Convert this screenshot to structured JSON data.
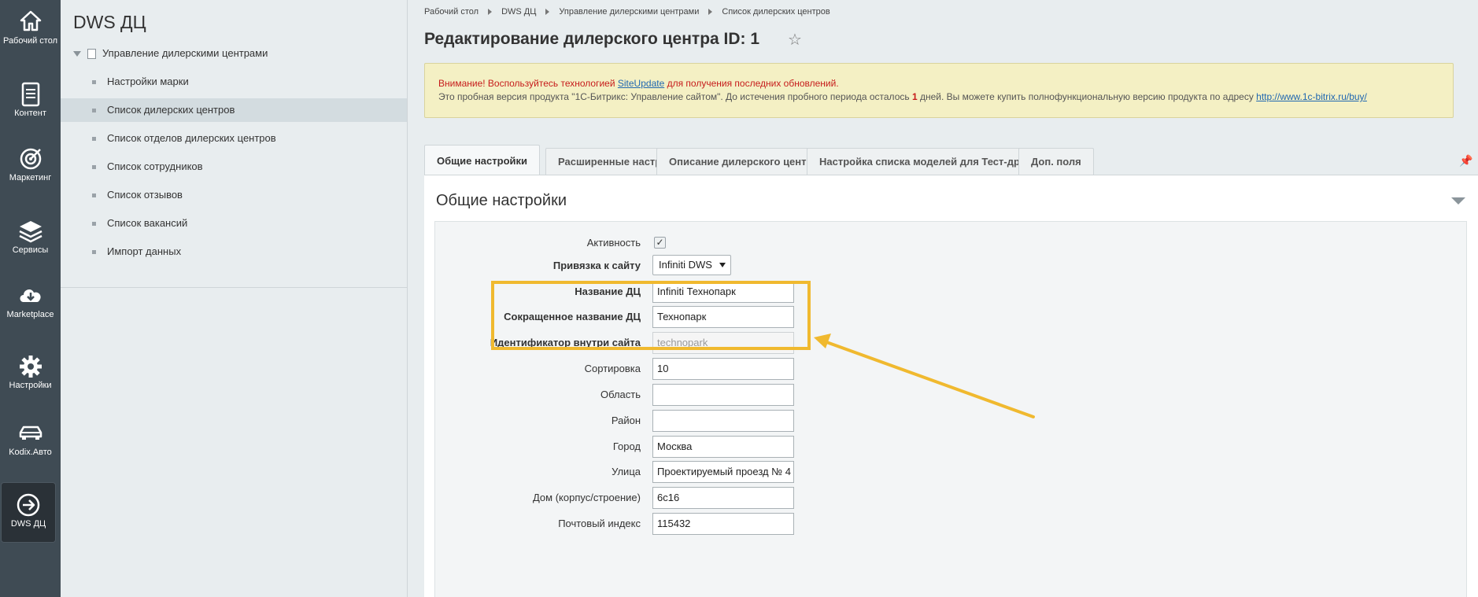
{
  "iconbar": {
    "items": [
      {
        "label": "Рабочий стол",
        "icon": "home-icon"
      },
      {
        "label": "Контент",
        "icon": "document-icon"
      },
      {
        "label": "Маркетинг",
        "icon": "target-icon"
      },
      {
        "label": "Сервисы",
        "icon": "layers-icon"
      },
      {
        "label": "Marketplace",
        "icon": "cloud-download-icon"
      },
      {
        "label": "Настройки",
        "icon": "gear-icon"
      },
      {
        "label": "Kodix.Авто",
        "icon": "car-icon"
      },
      {
        "label": "DWS ДЦ",
        "icon": "arrow-circle-icon"
      }
    ]
  },
  "menu": {
    "title": "DWS ДЦ",
    "root": "Управление дилерскими центрами",
    "items": [
      {
        "label": "Настройки марки"
      },
      {
        "label": "Список дилерских центров"
      },
      {
        "label": "Список отделов дилерских центров"
      },
      {
        "label": "Список сотрудников"
      },
      {
        "label": "Список отзывов"
      },
      {
        "label": "Список вакансий"
      },
      {
        "label": "Импорт данных"
      }
    ]
  },
  "breadcrumb": [
    "Рабочий стол",
    "DWS ДЦ",
    "Управление дилерскими центрами",
    "Список дилерских центров"
  ],
  "page": {
    "title": "Редактирование дилерского центра ID: 1",
    "star": "☆"
  },
  "notice": {
    "line1_prefix": "Внимание! Воспользуйтесь технологией ",
    "line1_link": "SiteUpdate",
    "line1_suffix": " для получения последних обновлений.",
    "line2_prefix": "Это пробная версия продукта \"1С-Битрикс: Управление сайтом\". До истечения пробного периода осталось ",
    "line2_days": "1",
    "line2_middle": " дней. Вы можете купить полнофункциональную версию продукта по адресу ",
    "line2_link": "http://www.1c-bitrix.ru/buy/"
  },
  "tabs": [
    {
      "label": "Общие настройки"
    },
    {
      "label": "Расширенные настройки"
    },
    {
      "label": "Описание дилерского центра"
    },
    {
      "label": "Настройка списка моделей для Тест-драйва"
    },
    {
      "label": "Доп. поля"
    }
  ],
  "section_title": "Общие настройки",
  "form": {
    "active_label": "Активность",
    "active_checked": true,
    "site_label": "Привязка к сайту",
    "site_value": "Infiniti DWS",
    "name_label": "Название ДЦ",
    "name_value": "Infiniti Технопарк",
    "short_label": "Сокращенное название ДЦ",
    "short_value": "Технопарк",
    "code_label": "Идентификатор внутри сайта",
    "code_value": "technopark",
    "sort_label": "Сортировка",
    "sort_value": "10",
    "region_label": "Область",
    "region_value": "",
    "district_label": "Район",
    "district_value": "",
    "city_label": "Город",
    "city_value": "Москва",
    "street_label": "Улица",
    "street_value": "Проектируемый проезд № 4",
    "house_label": "Дом (корпус/строение)",
    "house_value": "6с16",
    "zip_label": "Почтовый индекс",
    "zip_value": "115432"
  },
  "colors": {
    "iconbar_bg": "#3f4b54",
    "highlight": "#f0b92f",
    "notice_bg": "#f4f0c4",
    "link": "#2067b0",
    "warning_red": "#c61b1b"
  }
}
